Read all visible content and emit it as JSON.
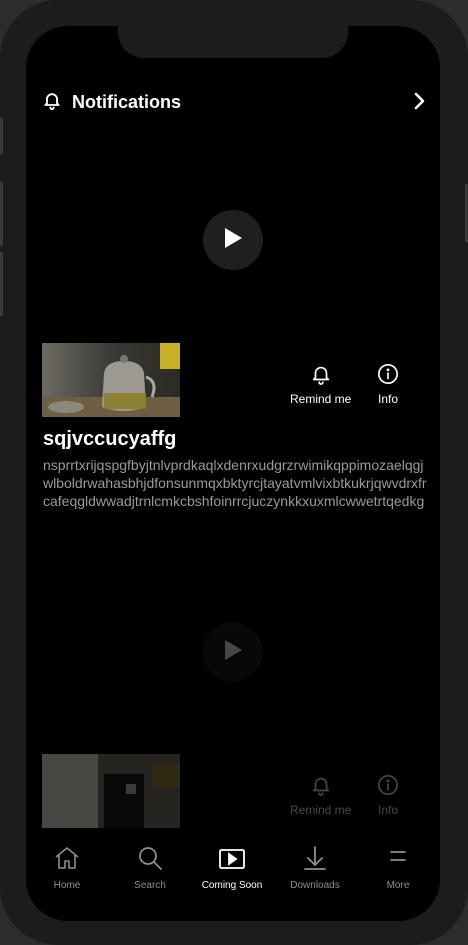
{
  "header": {
    "title": "Notifications",
    "bell_icon": "bell-icon",
    "chevron_icon": "chevron-right-icon"
  },
  "items": [
    {
      "title": "sqjvccucyaffg",
      "description": "nsprrtxrijqspgfbyjtnlvprdkaqlxdenrxudgrzrwimikqppimozaelqgjwlboldrwahasbhjdfonsunmqxbktyrcjtayatvmlvixbtkukrjqwvdrxfrcafeqgldwwadjtrnlcmkcbshfoinrrcjuczynkkxuxmlcwwetrtqedkg",
      "remind_label": "Remind me",
      "info_label": "Info"
    },
    {
      "remind_label": "Remind me",
      "info_label": "Info"
    }
  ],
  "tabs": [
    {
      "label": "Home",
      "icon": "home-icon",
      "active": false
    },
    {
      "label": "Search",
      "icon": "search-icon",
      "active": false
    },
    {
      "label": "Coming Soon",
      "icon": "play-square-icon",
      "active": true
    },
    {
      "label": "Downloads",
      "icon": "download-icon",
      "active": false
    },
    {
      "label": "More",
      "icon": "menu-icon",
      "active": false
    }
  ],
  "colors": {
    "background": "#000000",
    "inactive_tab": "#8e8e93",
    "active_tab": "#ffffff",
    "description": "#9a9a9a"
  }
}
